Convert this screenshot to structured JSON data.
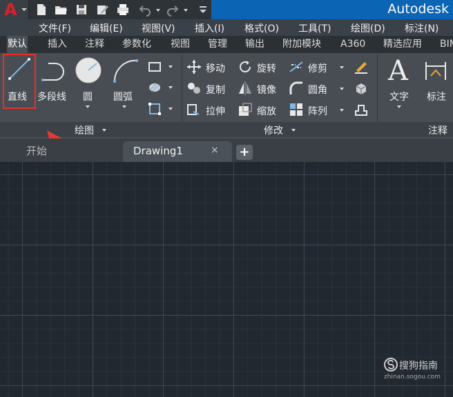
{
  "app": {
    "title": "Autodesk"
  },
  "menu": [
    {
      "label": "文件(F)"
    },
    {
      "label": "编辑(E)"
    },
    {
      "label": "视图(V)"
    },
    {
      "label": "插入(I)"
    },
    {
      "label": "格式(O)"
    },
    {
      "label": "工具(T)"
    },
    {
      "label": "绘图(D)"
    },
    {
      "label": "标注(N)"
    }
  ],
  "ribbon_tabs": [
    {
      "label": "默认",
      "active": true
    },
    {
      "label": "插入"
    },
    {
      "label": "注释"
    },
    {
      "label": "参数化"
    },
    {
      "label": "视图"
    },
    {
      "label": "管理"
    },
    {
      "label": "输出"
    },
    {
      "label": "附加模块"
    },
    {
      "label": "A360"
    },
    {
      "label": "精选应用"
    },
    {
      "label": "BIM"
    }
  ],
  "draw_panel": {
    "title": "绘图",
    "line": "直线",
    "polyline": "多段线",
    "circle": "圆",
    "arc": "圆弧"
  },
  "modify_panel": {
    "title": "修改",
    "move": "移动",
    "rotate": "旋转",
    "trim": "修剪",
    "copy": "复制",
    "mirror": "镜像",
    "fillet": "圆角",
    "stretch": "拉伸",
    "scale": "缩放",
    "array": "阵列"
  },
  "annotation_panel": {
    "title": "注释",
    "text": "文字",
    "dimension": "标注"
  },
  "file_tabs": {
    "start": "开始",
    "drawing": "Drawing1",
    "close_glyph": "×",
    "new_glyph": "+"
  },
  "watermark": {
    "text": "搜狗指南",
    "url": "zhinan.sogou.com"
  },
  "colors": {
    "accent_blue": "#0c64b4",
    "highlight_red": "#e8302a",
    "canvas_bg": "#212830"
  }
}
